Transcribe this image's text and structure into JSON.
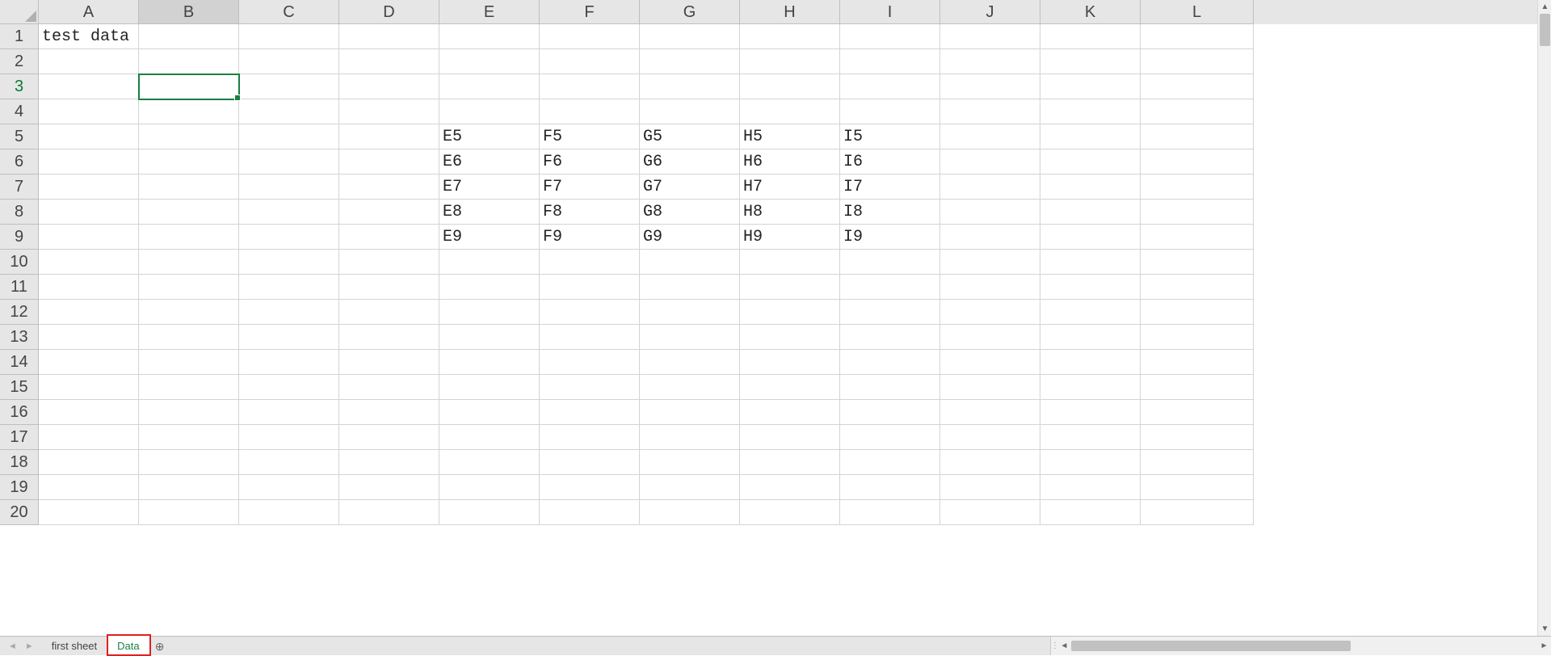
{
  "columns": [
    "A",
    "B",
    "C",
    "D",
    "E",
    "F",
    "G",
    "H",
    "I",
    "J",
    "K",
    "L"
  ],
  "rows": [
    "1",
    "2",
    "3",
    "4",
    "5",
    "6",
    "7",
    "8",
    "9",
    "10",
    "11",
    "12",
    "13",
    "14",
    "15",
    "16",
    "17",
    "18",
    "19",
    "20"
  ],
  "selected_cell": "B3",
  "active_column": "B",
  "active_row": "3",
  "cells": {
    "A1": "test data",
    "E5": "E5",
    "F5": "F5",
    "G5": "G5",
    "H5": "H5",
    "I5": "I5",
    "E6": "E6",
    "F6": "F6",
    "G6": "G6",
    "H6": "H6",
    "I6": "I6",
    "E7": "E7",
    "F7": "F7",
    "G7": "G7",
    "H7": "H7",
    "I7": "I7",
    "E8": "E8",
    "F8": "F8",
    "G8": "G8",
    "H8": "H8",
    "I8": "I8",
    "E9": "E9",
    "F9": "F9",
    "G9": "G9",
    "H9": "H9",
    "I9": "I9"
  },
  "sheets": {
    "tabs": [
      {
        "name": "first sheet",
        "active": false,
        "highlight": false
      },
      {
        "name": "Data",
        "active": true,
        "highlight": true
      }
    ],
    "add_label": "⊕"
  },
  "nav": {
    "prev": "◄",
    "next": "►"
  },
  "scroll": {
    "up": "▲",
    "down": "▼",
    "left": "◄",
    "right": "►",
    "grip": "⋮"
  }
}
